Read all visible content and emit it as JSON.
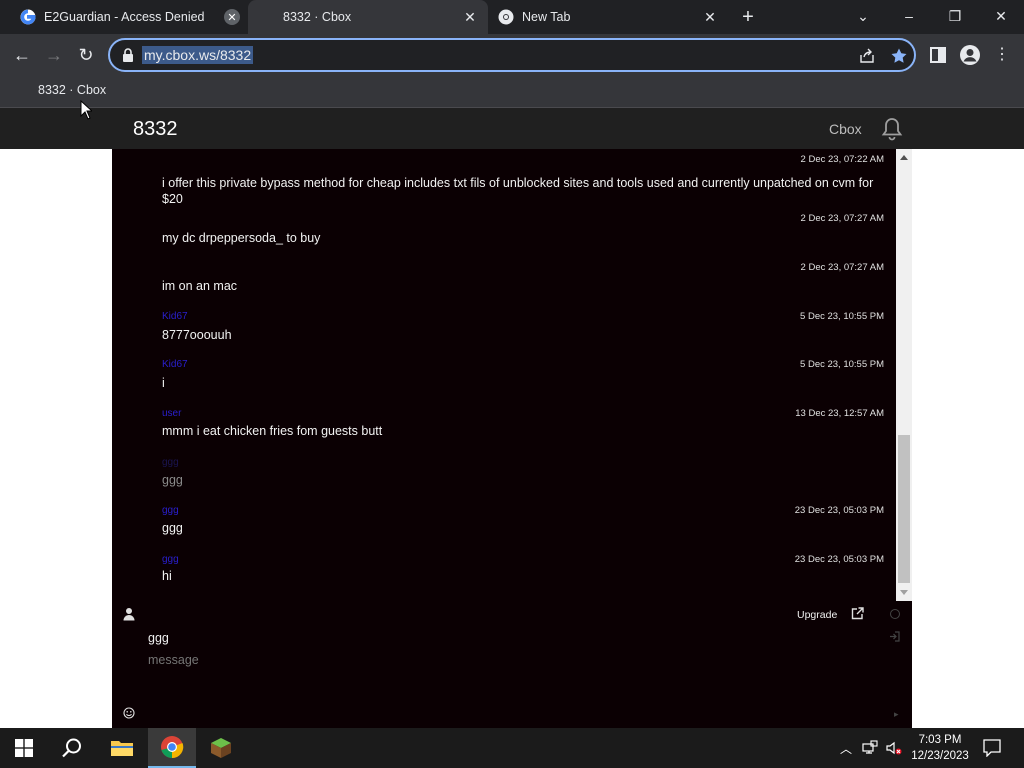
{
  "browser": {
    "tabs": [
      {
        "title": "E2Guardian - Access Denied",
        "icon": "google-icon"
      },
      {
        "title": "8332 · Cbox",
        "icon": "cbox-icon"
      },
      {
        "title": "New Tab",
        "icon": "chrome-icon"
      }
    ],
    "url": "my.cbox.ws/8332",
    "bookmarks": [
      "8332 · Cbox"
    ]
  },
  "page": {
    "room_name": "8332",
    "cbox_link": "Cbox"
  },
  "chat": {
    "messages": [
      {
        "name": "",
        "time": "2 Dec 23, 07:22 AM",
        "text": "i offer this private bypass method for cheap includes txt fils of unblocked sites and tools used and currently unpatched on cvm for $20"
      },
      {
        "name": "",
        "time": "2 Dec 23, 07:27 AM",
        "text": "my dc drpeppersoda_ to buy"
      },
      {
        "name": "",
        "time": "2 Dec 23, 07:27 AM",
        "text": "im on an mac"
      },
      {
        "name": "Kid67",
        "time": "5 Dec 23, 10:55 PM",
        "text": "8777ooouuh"
      },
      {
        "name": "Kid67",
        "time": "5 Dec 23, 10:55 PM",
        "text": "i"
      },
      {
        "name": "user",
        "time": "13 Dec 23, 12:57 AM",
        "text": "mmm i eat chicken fries fom guests butt"
      },
      {
        "name": "ggg",
        "time": "",
        "text": "ggg"
      },
      {
        "name": "ggg",
        "time": "23 Dec 23, 05:03 PM",
        "text": "ggg"
      },
      {
        "name": "ggg",
        "time": "23 Dec 23, 05:03 PM",
        "text": "hi"
      }
    ],
    "upgrade_label": "Upgrade",
    "name_value": "ggg",
    "message_placeholder": "message"
  },
  "taskbar": {
    "time": "7:03 PM",
    "date": "12/23/2023"
  },
  "colors": {
    "chat_bg": "#0b0003",
    "name_color": "#2a1fd0",
    "accent": "#8ab4f8"
  }
}
